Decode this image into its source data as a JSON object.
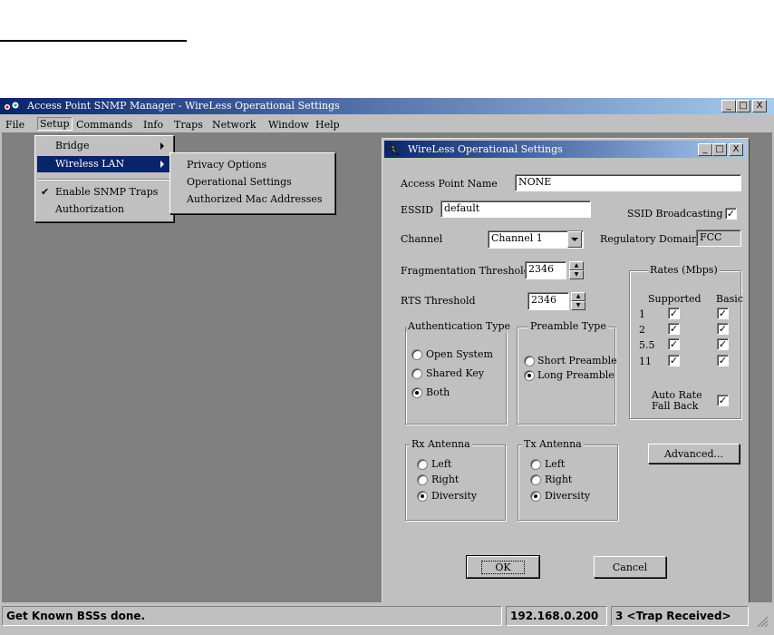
{
  "main_window": {
    "title": "Access Point SNMP Manager -  WireLess Operational Settings",
    "icon": "snmp-app-icon",
    "controls": {
      "minimize": "_",
      "maximize": "□",
      "close": "X"
    }
  },
  "menubar": {
    "items": [
      "File",
      "Setup",
      "Commands",
      "Info",
      "Traps",
      "Network",
      "Window",
      "Help"
    ]
  },
  "setup_menu": {
    "items": [
      "Bridge",
      "Wireless LAN",
      "Enable SNMP Traps",
      "Authorization"
    ],
    "checked_mark": "✔"
  },
  "wireless_submenu": {
    "items": [
      "Privacy Options",
      "Operational Settings",
      "Authorized Mac Addresses"
    ]
  },
  "child_window": {
    "title": "WireLess Operational Settings",
    "icon": "lightning-icon",
    "controls": {
      "minimize": "_",
      "maximize": "□",
      "close": "X"
    }
  },
  "form": {
    "ap_name_label": "Access Point Name",
    "ap_name_value": "NONE",
    "essid_label": "ESSID",
    "essid_value": "default",
    "ssid_broadcast_label": "SSID Broadcasting",
    "ssid_broadcast_checked": true,
    "channel_label": "Channel",
    "channel_value": "Channel 1",
    "reg_domain_label": "Regulatory Domain",
    "reg_domain_value": "FCC",
    "frag_label": "Fragmentation Threshold",
    "frag_value": "2346",
    "rts_label": "RTS Threshold",
    "rts_value": "2346",
    "check_mark": "✓"
  },
  "rates": {
    "legend": "Rates (Mbps)",
    "supported_header": "Supported",
    "basic_header": "Basic",
    "rows": [
      {
        "rate": "1",
        "supported": true,
        "basic": true
      },
      {
        "rate": "2",
        "supported": true,
        "basic": true
      },
      {
        "rate": "5.5",
        "supported": true,
        "basic": true
      },
      {
        "rate": "11",
        "supported": true,
        "basic": true
      }
    ],
    "auto_rate_line1": "Auto Rate",
    "auto_rate_line2": "Fall Back",
    "auto_rate_checked": true
  },
  "auth_type": {
    "legend": "Authentication Type",
    "options": [
      "Open System",
      "Shared Key",
      "Both"
    ],
    "selected": "Both"
  },
  "preamble_type": {
    "legend": "Preamble Type",
    "options": [
      "Short Preamble",
      "Long Preamble"
    ],
    "selected": "Long Preamble"
  },
  "rx_antenna": {
    "legend": "Rx Antenna",
    "options": [
      "Left",
      "Right",
      "Diversity"
    ],
    "selected": "Diversity"
  },
  "tx_antenna": {
    "legend": "Tx Antenna",
    "options": [
      "Left",
      "Right",
      "Diversity"
    ],
    "selected": "Diversity"
  },
  "buttons": {
    "advanced": "Advanced...",
    "ok": "OK",
    "cancel": "Cancel"
  },
  "statusbar": {
    "message": "Get Known BSSs done.",
    "ip": "192.168.0.200",
    "traps": "3 <Trap Received>"
  }
}
